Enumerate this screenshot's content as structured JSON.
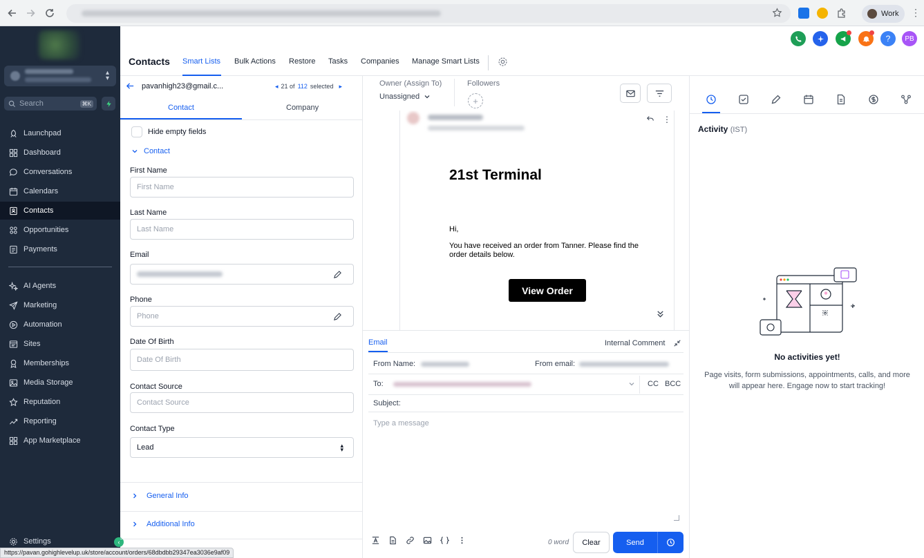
{
  "browser": {
    "profile_label": "Work",
    "status_url": "https://pavan.gohighlevelup.uk/store/account/orders/68dbdbb29347ea3036e9af09"
  },
  "sidebar": {
    "search_placeholder": "Search",
    "search_shortcut": "⌘K",
    "items": [
      {
        "label": "Launchpad",
        "icon": "rocket-icon"
      },
      {
        "label": "Dashboard",
        "icon": "grid-icon"
      },
      {
        "label": "Conversations",
        "icon": "chat-icon"
      },
      {
        "label": "Calendars",
        "icon": "calendar-icon"
      },
      {
        "label": "Contacts",
        "icon": "contacts-icon",
        "active": true
      },
      {
        "label": "Opportunities",
        "icon": "opportunities-icon"
      },
      {
        "label": "Payments",
        "icon": "payments-icon"
      },
      {
        "label": "AI Agents",
        "icon": "sparkle-icon"
      },
      {
        "label": "Marketing",
        "icon": "send-icon"
      },
      {
        "label": "Automation",
        "icon": "automation-icon"
      },
      {
        "label": "Sites",
        "icon": "sites-icon"
      },
      {
        "label": "Memberships",
        "icon": "memberships-icon"
      },
      {
        "label": "Media Storage",
        "icon": "media-icon"
      },
      {
        "label": "Reputation",
        "icon": "star-icon"
      },
      {
        "label": "Reporting",
        "icon": "chart-icon"
      },
      {
        "label": "App Marketplace",
        "icon": "apps-icon"
      }
    ],
    "settings_label": "Settings"
  },
  "header": {
    "title": "Contacts",
    "tabs": [
      {
        "label": "Smart Lists",
        "active": true
      },
      {
        "label": "Bulk Actions"
      },
      {
        "label": "Restore"
      },
      {
        "label": "Tasks"
      },
      {
        "label": "Companies"
      },
      {
        "label": "Manage Smart Lists"
      }
    ],
    "avatar_initials": "PB",
    "icon_colors": {
      "phone": "#1e9e57",
      "ai": "#2563eb",
      "megaphone": "#16a34a",
      "bell": "#f97316",
      "help": "#3b82f6",
      "avatar": "#a855f7"
    }
  },
  "contact_nav": {
    "email": "pavanhigh23@gmail.c...",
    "position": "21 of",
    "total": "112",
    "selected": "selected"
  },
  "left_panel": {
    "tabs": [
      "Contact",
      "Company"
    ],
    "hide_empty_label": "Hide empty fields",
    "section_contact": "Contact",
    "fields": {
      "first_name": {
        "label": "First Name",
        "placeholder": "First Name"
      },
      "last_name": {
        "label": "Last Name",
        "placeholder": "Last Name"
      },
      "email": {
        "label": "Email"
      },
      "phone": {
        "label": "Phone",
        "placeholder": "Phone"
      },
      "dob": {
        "label": "Date Of Birth",
        "placeholder": "Date Of Birth"
      },
      "source": {
        "label": "Contact Source",
        "placeholder": "Contact Source"
      },
      "type": {
        "label": "Contact Type",
        "value": "Lead"
      }
    },
    "section_general": "General Info",
    "section_additional": "Additional Info"
  },
  "conversation": {
    "owner_label": "Owner (Assign To)",
    "owner_value": "Unassigned",
    "followers_label": "Followers",
    "email_preview": {
      "title": "21st Terminal",
      "greeting": "Hi,",
      "body": "You have received an order from Tanner. Please find the order details below.",
      "button": "View Order"
    },
    "composer": {
      "tab_email": "Email",
      "tab_internal": "Internal Comment",
      "from_name_label": "From Name:",
      "from_email_label": "From email:",
      "to_label": "To:",
      "cc": "CC",
      "bcc": "BCC",
      "subject_label": "Subject:",
      "message_placeholder": "Type a message",
      "word_count": "0 word",
      "clear": "Clear",
      "send": "Send"
    }
  },
  "activity": {
    "title": "Activity",
    "timezone": "(IST)",
    "empty_title": "No activities yet!",
    "empty_text": "Page visits, form submissions, appointments, calls, and more will appear here. Engage now to start tracking!"
  }
}
